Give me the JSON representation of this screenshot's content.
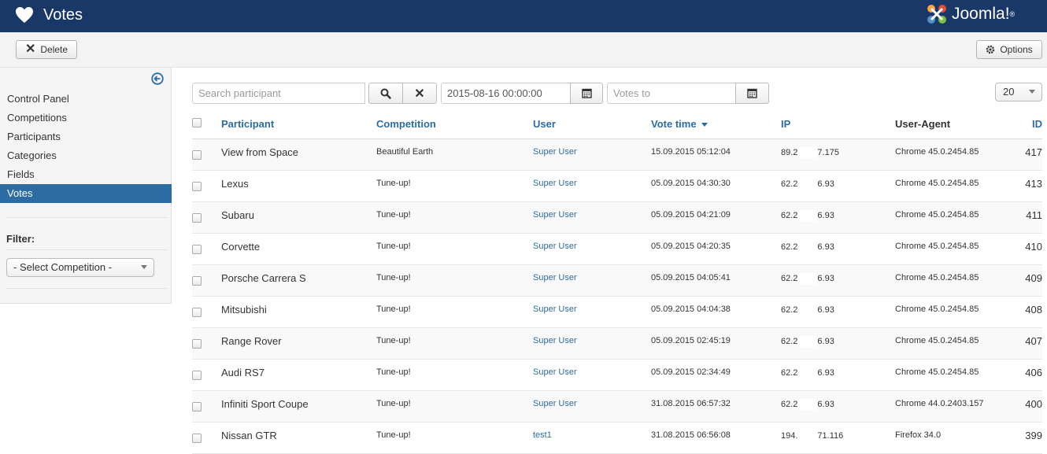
{
  "header": {
    "title": "Votes",
    "logo_text": "Joomla!",
    "logo_mark": "®"
  },
  "toolbar": {
    "delete_label": "Delete",
    "options_label": "Options"
  },
  "sidebar": {
    "items": [
      {
        "label": "Control Panel"
      },
      {
        "label": "Competitions"
      },
      {
        "label": "Participants"
      },
      {
        "label": "Categories"
      },
      {
        "label": "Fields"
      },
      {
        "label": "Votes",
        "active": true
      }
    ],
    "filter_label": "Filter:",
    "competition_select": "- Select Competition -"
  },
  "filters": {
    "search_placeholder": "Search participant",
    "votes_from": "2015-08-16 00:00:00",
    "votes_to_placeholder": "Votes to",
    "limit": "20"
  },
  "table": {
    "headers": {
      "participant": "Participant",
      "competition": "Competition",
      "user": "User",
      "vote_time": "Vote time",
      "ip": "IP",
      "user_agent": "User-Agent",
      "id": "ID"
    },
    "rows": [
      {
        "participant": "View from Space",
        "competition": "Beautiful Earth",
        "user": "Super User",
        "time": "15.09.2015 05:12:04",
        "ip_a": "89.2",
        "ip_b": "7.175",
        "agent": "Chrome 45.0.2454.85",
        "id": "417"
      },
      {
        "participant": "Lexus",
        "competition": "Tune-up!",
        "user": "Super User",
        "time": "05.09.2015 04:30:30",
        "ip_a": "62.2",
        "ip_b": "6.93",
        "agent": "Chrome 45.0.2454.85",
        "id": "413"
      },
      {
        "participant": "Subaru",
        "competition": "Tune-up!",
        "user": "Super User",
        "time": "05.09.2015 04:21:09",
        "ip_a": "62.2",
        "ip_b": "6.93",
        "agent": "Chrome 45.0.2454.85",
        "id": "411"
      },
      {
        "participant": "Corvette",
        "competition": "Tune-up!",
        "user": "Super User",
        "time": "05.09.2015 04:20:35",
        "ip_a": "62.2",
        "ip_b": "6.93",
        "agent": "Chrome 45.0.2454.85",
        "id": "410"
      },
      {
        "participant": "Porsche Carrera S",
        "competition": "Tune-up!",
        "user": "Super User",
        "time": "05.09.2015 04:05:41",
        "ip_a": "62.2",
        "ip_b": "6.93",
        "agent": "Chrome 45.0.2454.85",
        "id": "409"
      },
      {
        "participant": "Mitsubishi",
        "competition": "Tune-up!",
        "user": "Super User",
        "time": "05.09.2015 04:04:38",
        "ip_a": "62.2",
        "ip_b": "6.93",
        "agent": "Chrome 45.0.2454.85",
        "id": "408"
      },
      {
        "participant": "Range Rover",
        "competition": "Tune-up!",
        "user": "Super User",
        "time": "05.09.2015 02:45:19",
        "ip_a": "62.2",
        "ip_b": "6.93",
        "agent": "Chrome 45.0.2454.85",
        "id": "407"
      },
      {
        "participant": "Audi RS7",
        "competition": "Tune-up!",
        "user": "Super User",
        "time": "05.09.2015 02:34:49",
        "ip_a": "62.2",
        "ip_b": "6.93",
        "agent": "Chrome 45.0.2454.85",
        "id": "406"
      },
      {
        "participant": "Infiniti Sport Coupe",
        "competition": "Tune-up!",
        "user": "Super User",
        "time": "31.08.2015 06:57:32",
        "ip_a": "62.2",
        "ip_b": "6.93",
        "agent": "Chrome 44.0.2403.157",
        "id": "400"
      },
      {
        "participant": "Nissan GTR",
        "competition": "Tune-up!",
        "user": "test1",
        "time": "31.08.2015 06:56:08",
        "ip_a": "194.",
        "ip_b": "71.116",
        "agent": "Firefox 34.0",
        "id": "399"
      }
    ]
  },
  "colors": {
    "header_bg": "#1a3867",
    "accent": "#2d6ca2"
  },
  "icons": [
    "heart-icon",
    "joomla-logo-icon",
    "close-icon",
    "gear-icon",
    "arrow-left-circle-icon",
    "search-icon",
    "calendar-icon",
    "chevron-down-icon",
    "sort-desc-icon"
  ]
}
